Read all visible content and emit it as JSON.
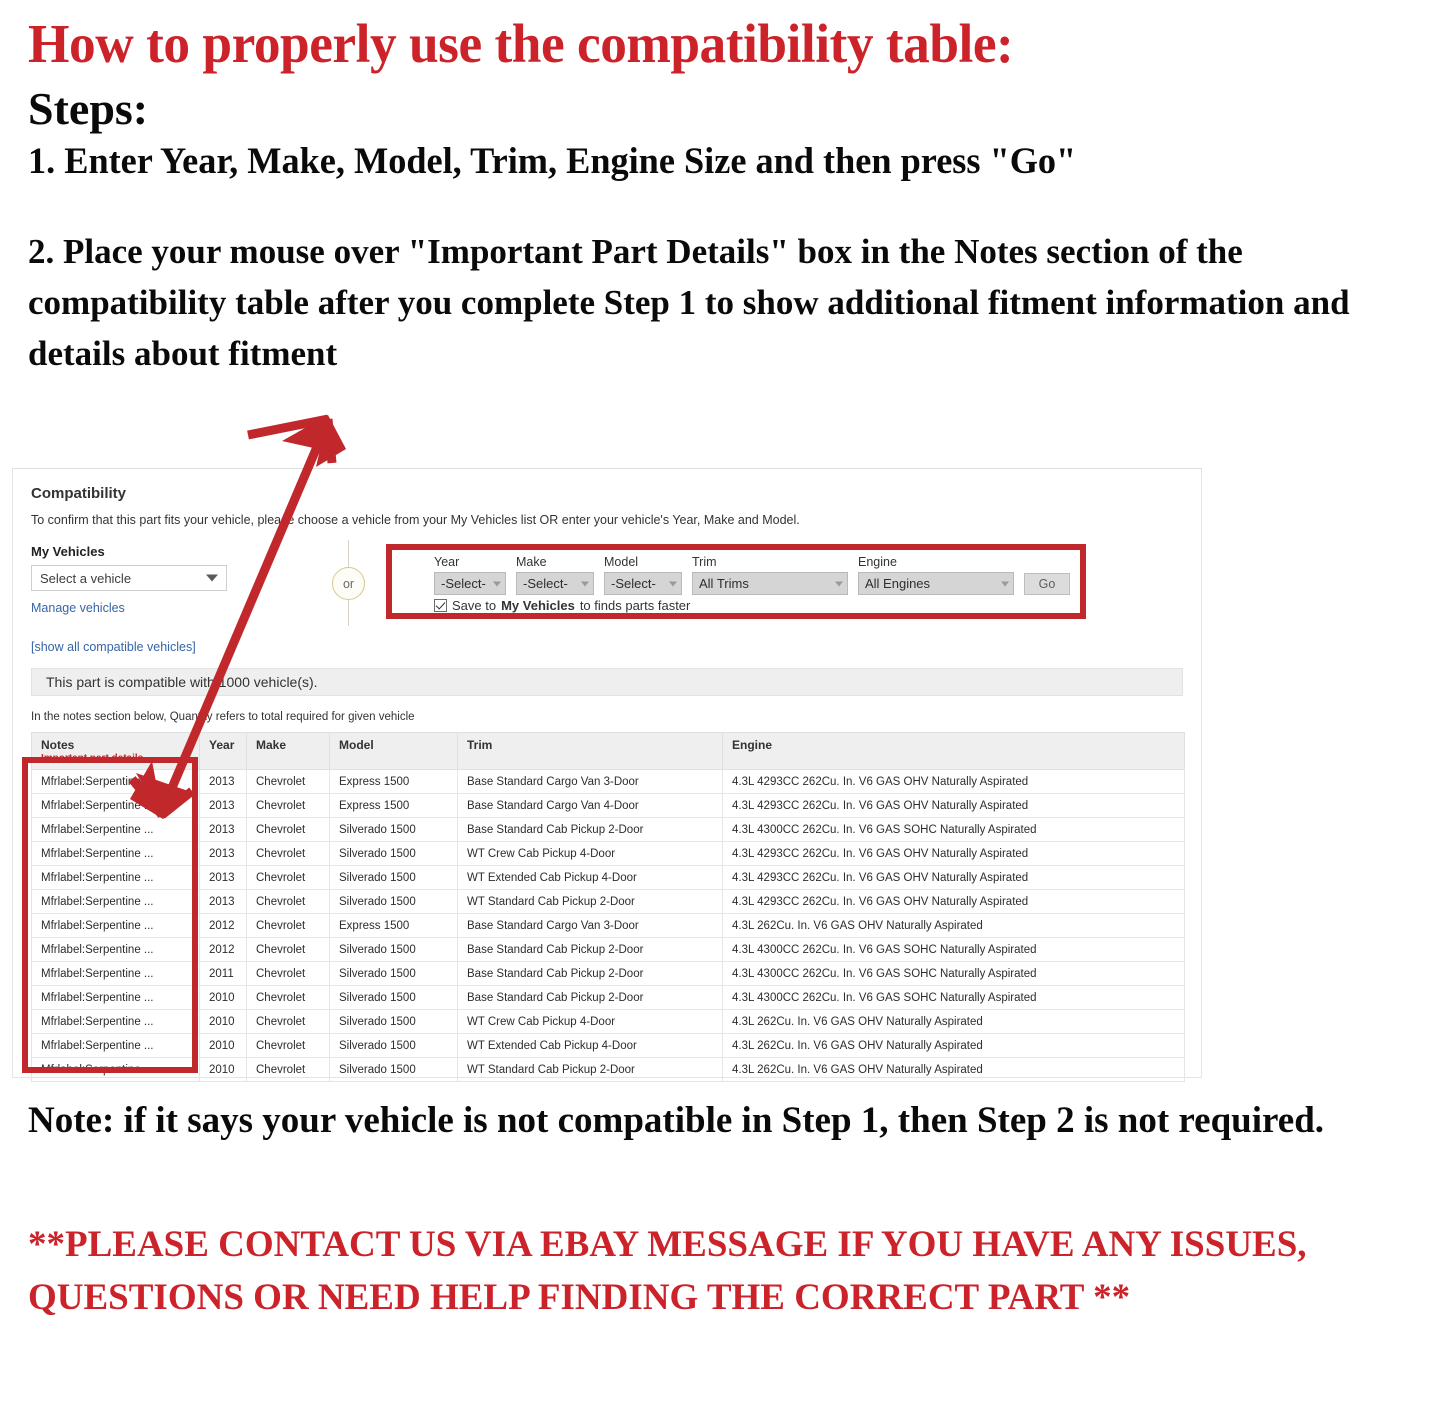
{
  "headline": {
    "title": "How to properly use the compatibility table:",
    "steps_label": "Steps:",
    "step_one": "1. Enter Year, Make, Model, Trim, Engine Size and then press \"Go\"",
    "step_two": "2. Place your mouse over \"Important Part Details\" box in the Notes section of the compatibility table after you complete Step 1 to show additional fitment information and details about fitment",
    "note": "Note: if it says your vehicle is not compatible in Step 1, then Step 2 is not required.",
    "contact": "**PLEASE CONTACT US VIA EBAY MESSAGE IF YOU HAVE ANY ISSUES, QUESTIONS OR NEED HELP FINDING THE CORRECT PART **"
  },
  "colors": {
    "title_red": "#cc2229",
    "box_red": "#c0282c",
    "link_blue": "#3665a7",
    "header_gray": "#efefef"
  },
  "compatibility": {
    "title": "Compatibility",
    "subtitle": "To confirm that this part fits your vehicle, please choose a vehicle from your My Vehicles list OR enter your vehicle's Year, Make and Model.",
    "my_vehicles": {
      "label": "My Vehicles",
      "select_value": "Select a vehicle",
      "manage_link": "Manage vehicles"
    },
    "or_label": "or",
    "form": {
      "fields": [
        {
          "label": "Year",
          "value": "-Select-"
        },
        {
          "label": "Make",
          "value": "-Select-"
        },
        {
          "label": "Model",
          "value": "-Select-"
        },
        {
          "label": "Trim",
          "value": "All Trims"
        },
        {
          "label": "Engine",
          "value": "All Engines"
        }
      ],
      "go_label": "Go",
      "save_checked": true,
      "save_text_pre": "Save to ",
      "save_text_bold": "My Vehicles",
      "save_text_post": " to finds parts faster"
    },
    "show_all_link": "[show all compatible vehicles]",
    "count_text": "This part is compatible with 1000 vehicle(s).",
    "qty_note": "In the notes section below, Quantity refers to total required for given vehicle",
    "table": {
      "headers": {
        "notes": "Notes",
        "notes_sub": "Important part details",
        "year": "Year",
        "make": "Make",
        "model": "Model",
        "trim": "Trim",
        "engine": "Engine"
      },
      "rows": [
        {
          "notes": "Mfrlabel:Serpentine ...",
          "year": "2013",
          "make": "Chevrolet",
          "model": "Express 1500",
          "trim": "Base Standard Cargo Van 3-Door",
          "engine": "4.3L 4293CC 262Cu. In. V6 GAS OHV Naturally Aspirated"
        },
        {
          "notes": "Mfrlabel:Serpentine ...",
          "year": "2013",
          "make": "Chevrolet",
          "model": "Express 1500",
          "trim": "Base Standard Cargo Van 4-Door",
          "engine": "4.3L 4293CC 262Cu. In. V6 GAS OHV Naturally Aspirated"
        },
        {
          "notes": "Mfrlabel:Serpentine ...",
          "year": "2013",
          "make": "Chevrolet",
          "model": "Silverado 1500",
          "trim": "Base Standard Cab Pickup 2-Door",
          "engine": "4.3L 4300CC 262Cu. In. V6 GAS SOHC Naturally Aspirated"
        },
        {
          "notes": "Mfrlabel:Serpentine ...",
          "year": "2013",
          "make": "Chevrolet",
          "model": "Silverado 1500",
          "trim": "WT Crew Cab Pickup 4-Door",
          "engine": "4.3L 4293CC 262Cu. In. V6 GAS OHV Naturally Aspirated"
        },
        {
          "notes": "Mfrlabel:Serpentine ...",
          "year": "2013",
          "make": "Chevrolet",
          "model": "Silverado 1500",
          "trim": "WT Extended Cab Pickup 4-Door",
          "engine": "4.3L 4293CC 262Cu. In. V6 GAS OHV Naturally Aspirated"
        },
        {
          "notes": "Mfrlabel:Serpentine ...",
          "year": "2013",
          "make": "Chevrolet",
          "model": "Silverado 1500",
          "trim": "WT Standard Cab Pickup 2-Door",
          "engine": "4.3L 4293CC 262Cu. In. V6 GAS OHV Naturally Aspirated"
        },
        {
          "notes": "Mfrlabel:Serpentine ...",
          "year": "2012",
          "make": "Chevrolet",
          "model": "Express 1500",
          "trim": "Base Standard Cargo Van 3-Door",
          "engine": "4.3L 262Cu. In. V6 GAS OHV Naturally Aspirated"
        },
        {
          "notes": "Mfrlabel:Serpentine ...",
          "year": "2012",
          "make": "Chevrolet",
          "model": "Silverado 1500",
          "trim": "Base Standard Cab Pickup 2-Door",
          "engine": "4.3L 4300CC 262Cu. In. V6 GAS SOHC Naturally Aspirated"
        },
        {
          "notes": "Mfrlabel:Serpentine ...",
          "year": "2011",
          "make": "Chevrolet",
          "model": "Silverado 1500",
          "trim": "Base Standard Cab Pickup 2-Door",
          "engine": "4.3L 4300CC 262Cu. In. V6 GAS SOHC Naturally Aspirated"
        },
        {
          "notes": "Mfrlabel:Serpentine ...",
          "year": "2010",
          "make": "Chevrolet",
          "model": "Silverado 1500",
          "trim": "Base Standard Cab Pickup 2-Door",
          "engine": "4.3L 4300CC 262Cu. In. V6 GAS SOHC Naturally Aspirated"
        },
        {
          "notes": "Mfrlabel:Serpentine ...",
          "year": "2010",
          "make": "Chevrolet",
          "model": "Silverado 1500",
          "trim": "WT Crew Cab Pickup 4-Door",
          "engine": "4.3L 262Cu. In. V6 GAS OHV Naturally Aspirated"
        },
        {
          "notes": "Mfrlabel:Serpentine ...",
          "year": "2010",
          "make": "Chevrolet",
          "model": "Silverado 1500",
          "trim": "WT Extended Cab Pickup 4-Door",
          "engine": "4.3L 262Cu. In. V6 GAS OHV Naturally Aspirated"
        },
        {
          "notes": "Mfrlabel:Serpentine ...",
          "year": "2010",
          "make": "Chevrolet",
          "model": "Silverado 1500",
          "trim": "WT Standard Cab Pickup 2-Door",
          "engine": "4.3L 262Cu. In. V6 GAS OHV Naturally Aspirated"
        }
      ]
    }
  }
}
